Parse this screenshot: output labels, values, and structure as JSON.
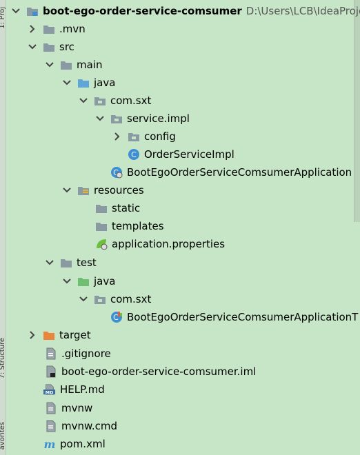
{
  "left_strip": {
    "top_label": "1: Proj",
    "bottom_label": "7: Structure",
    "bottom2_label": "avorites"
  },
  "tree": {
    "root": {
      "label": "boot-ego-order-service-comsumer",
      "path": "D:\\Users\\LCB\\IdeaProject"
    },
    "items": [
      {
        "label": ".mvn"
      },
      {
        "label": "src"
      },
      {
        "label": "main"
      },
      {
        "label": "java"
      },
      {
        "label": "com.sxt"
      },
      {
        "label": "service.impl"
      },
      {
        "label": "config"
      },
      {
        "label": "OrderServiceImpl"
      },
      {
        "label": "BootEgoOrderServiceComsumerApplication"
      },
      {
        "label": "resources"
      },
      {
        "label": "static"
      },
      {
        "label": "templates"
      },
      {
        "label": "application.properties"
      },
      {
        "label": "test"
      },
      {
        "label": "java"
      },
      {
        "label": "com.sxt"
      },
      {
        "label": "BootEgoOrderServiceComsumerApplicationT"
      },
      {
        "label": "target"
      },
      {
        "label": ".gitignore"
      },
      {
        "label": "boot-ego-order-service-comsumer.iml"
      },
      {
        "label": "HELP.md"
      },
      {
        "label": "mvnw"
      },
      {
        "label": "mvnw.cmd"
      },
      {
        "label": "pom.xml"
      }
    ]
  },
  "colors": {
    "background": "#c7e6c7",
    "folder": "#8a9aa3",
    "source_folder": "#5ea6d8",
    "test_folder": "#6fbf73",
    "excluded_folder": "#e9853d",
    "class_icon": "#3d8fd1"
  }
}
